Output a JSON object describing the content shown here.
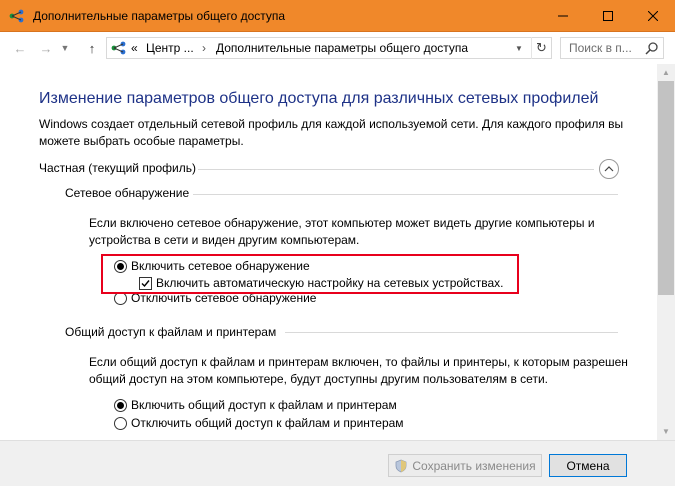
{
  "window": {
    "title": "Дополнительные параметры общего доступа",
    "accent_color": "#f0882a"
  },
  "addressbar": {
    "overflow": "«",
    "crumb1": "Центр ...",
    "crumb2": "Дополнительные параметры общего доступа",
    "search_placeholder": "Поиск в п..."
  },
  "content": {
    "heading": "Изменение параметров общего доступа для различных сетевых профилей",
    "description": "Windows создает отдельный сетевой профиль для каждой используемой сети. Для каждого профиля вы можете выбрать особые параметры.",
    "profile_label": "Частная (текущий профиль)",
    "sections": {
      "discovery": {
        "title": "Сетевое обнаружение",
        "text": "Если включено сетевое обнаружение, этот компьютер может видеть другие компьютеры и устройства в сети и виден другим компьютерам.",
        "opt_on": "Включить сетевое обнаружение",
        "opt_auto": "Включить автоматическую настройку на сетевых устройствах.",
        "opt_off": "Отключить сетевое обнаружение",
        "selected": "on",
        "auto_checked": true
      },
      "sharing": {
        "title": "Общий доступ к файлам и принтерам",
        "text": "Если общий доступ к файлам и принтерам включен, то файлы и принтеры, к которым разрешен общий доступ на этом компьютере, будут доступны другим пользователям в сети.",
        "opt_on": "Включить общий доступ к файлам и принтерам",
        "opt_off": "Отключить общий доступ к файлам и принтерам",
        "selected": "on"
      }
    },
    "highlight_color": "#e8001c"
  },
  "footer": {
    "save_label": "Сохранить изменения",
    "cancel_label": "Отмена"
  }
}
